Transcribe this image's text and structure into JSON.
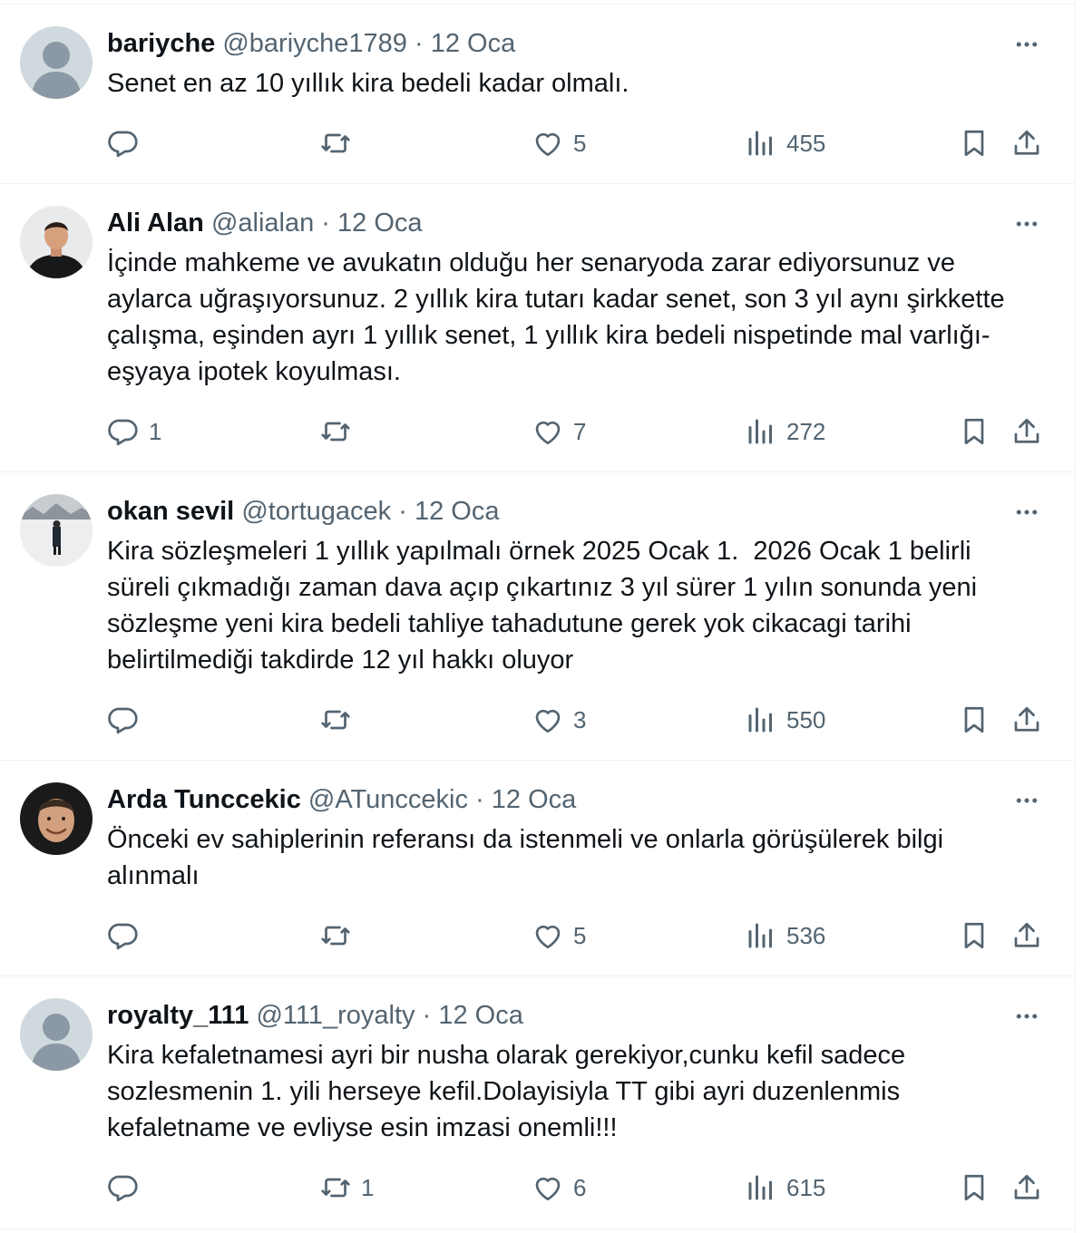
{
  "colors": {
    "text_primary": "#0f1419",
    "text_secondary": "#536471",
    "divider": "#eff3f4",
    "default_avatar_bg": "#cfd9de"
  },
  "icons": {
    "reply": "reply-icon",
    "retweet": "retweet-icon",
    "like": "heart-icon",
    "views": "views-icon",
    "bookmark": "bookmark-icon",
    "share": "share-icon",
    "more": "more-icon"
  },
  "tweets": [
    {
      "name": "bariyche",
      "handle": "@bariyche1789",
      "separator": "·",
      "date": "12 Oca",
      "text": "Senet en az 10 yıllık kira bedeli kadar olmalı.",
      "avatar": "default",
      "replies": "",
      "retweets": "",
      "likes": "5",
      "views": "455"
    },
    {
      "name": "Ali Alan",
      "handle": "@alialan",
      "separator": "·",
      "date": "12 Oca",
      "text": "İçinde mahkeme ve avukatın olduğu her senaryoda zarar ediyorsunuz ve aylarca uğraşıyorsunuz. 2 yıllık kira tutarı kadar senet, son 3 yıl aynı şirkkette çalışma, eşinden ayrı 1 yıllık senet, 1 yıllık kira bedeli nispetinde mal varlığı-eşyaya ipotek koyulması.",
      "avatar": "photo",
      "replies": "1",
      "retweets": "",
      "likes": "7",
      "views": "272"
    },
    {
      "name": "okan sevil",
      "handle": "@tortugacek",
      "separator": "·",
      "date": "12 Oca",
      "text": "Kira sözleşmeleri 1 yıllık yapılmalı örnek 2025 Ocak 1.  2026 Ocak 1 belirli süreli çıkmadığı zaman dava açıp çıkartınız 3 yıl sürer 1 yılın sonunda yeni sözleşme yeni kira bedeli tahliye tahadutune gerek yok cikacagi tarihi belirtilmediği takdirde 12 yıl hakkı oluyor",
      "avatar": "photo",
      "replies": "",
      "retweets": "",
      "likes": "3",
      "views": "550"
    },
    {
      "name": "Arda Tunccekic",
      "handle": "@ATunccekic",
      "separator": "·",
      "date": "12 Oca",
      "text": "Önceki ev sahiplerinin referansı da istenmeli ve onlarla görüşülerek bilgi alınmalı",
      "avatar": "photo",
      "replies": "",
      "retweets": "",
      "likes": "5",
      "views": "536"
    },
    {
      "name": "royalty_111",
      "handle": "@111_royalty",
      "separator": "·",
      "date": "12 Oca",
      "text": "Kira kefaletnamesi ayri bir nusha olarak gerekiyor,cunku kefil sadece sozlesmenin 1. yili herseye kefil.Dolayisiyla TT gibi ayri duzenlenmis kefaletname ve evliyse esin imzasi onemli!!!",
      "avatar": "default",
      "replies": "",
      "retweets": "1",
      "likes": "6",
      "views": "615"
    }
  ]
}
